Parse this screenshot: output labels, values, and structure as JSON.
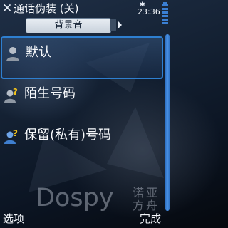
{
  "header": {
    "title": "通话伪装 (关)",
    "close_icon": "close-icon",
    "status": {
      "time": "23:36",
      "bluetooth_icon": "bluetooth-icon",
      "battery_icon": "battery-icon"
    }
  },
  "tabs": {
    "active_label": "背景音",
    "next_icon": "chevron-right-icon"
  },
  "list": {
    "items": [
      {
        "label": "默认",
        "icon": "person-icon",
        "selected": true
      },
      {
        "label": "陌生号码",
        "icon": "unknown-person-icon",
        "selected": false
      },
      {
        "label": "保留(私有)号码",
        "icon": "private-person-icon",
        "selected": false
      }
    ]
  },
  "watermark": {
    "latin": "Dospy",
    "cjk": "诺亚方舟"
  },
  "softkeys": {
    "left": "选项",
    "right": "完成"
  },
  "colors": {
    "accent": "#2e7fd0",
    "text": "#f4f7fb",
    "background": "#142133"
  }
}
